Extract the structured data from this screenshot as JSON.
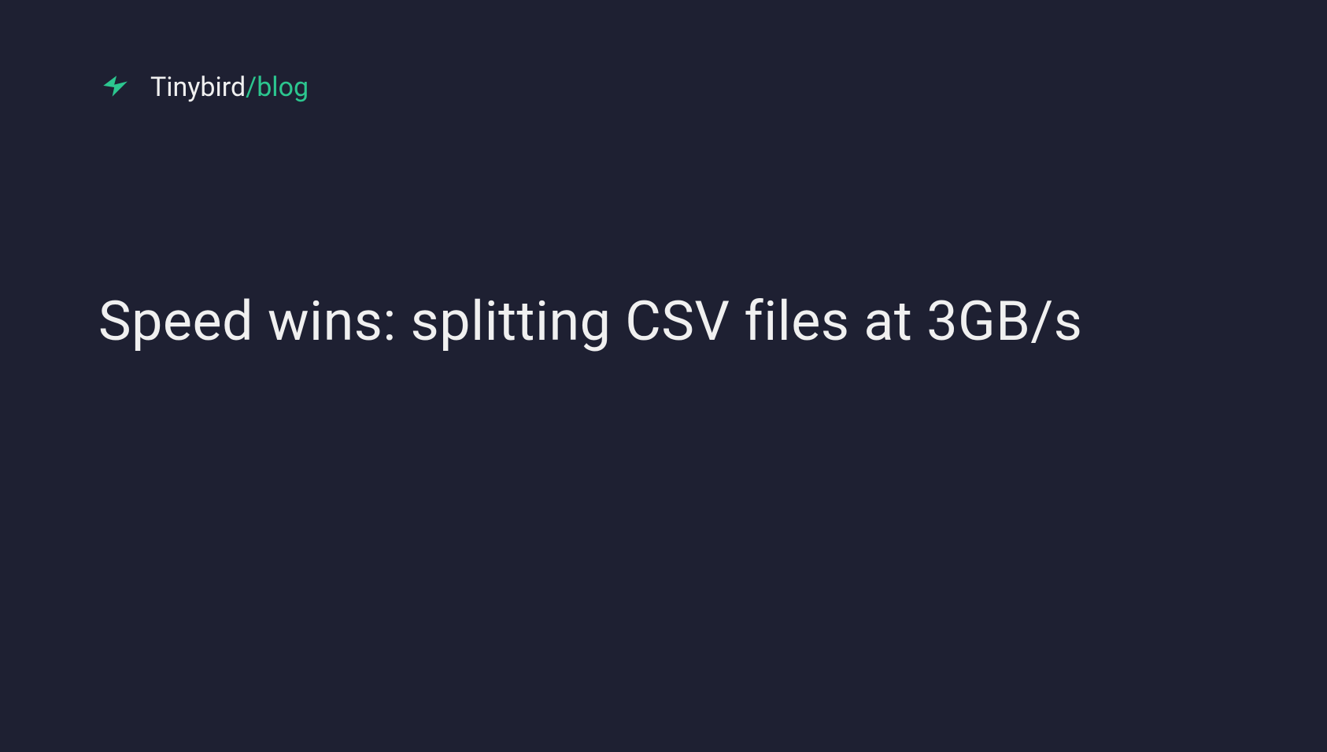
{
  "header": {
    "brand_name": "Tinybird",
    "slash": "/",
    "section": "blog"
  },
  "title": "Speed wins: splitting CSV files at 3GB/s",
  "colors": {
    "background": "#1E2032",
    "text": "#F0F0F0",
    "accent": "#2CC68F"
  }
}
